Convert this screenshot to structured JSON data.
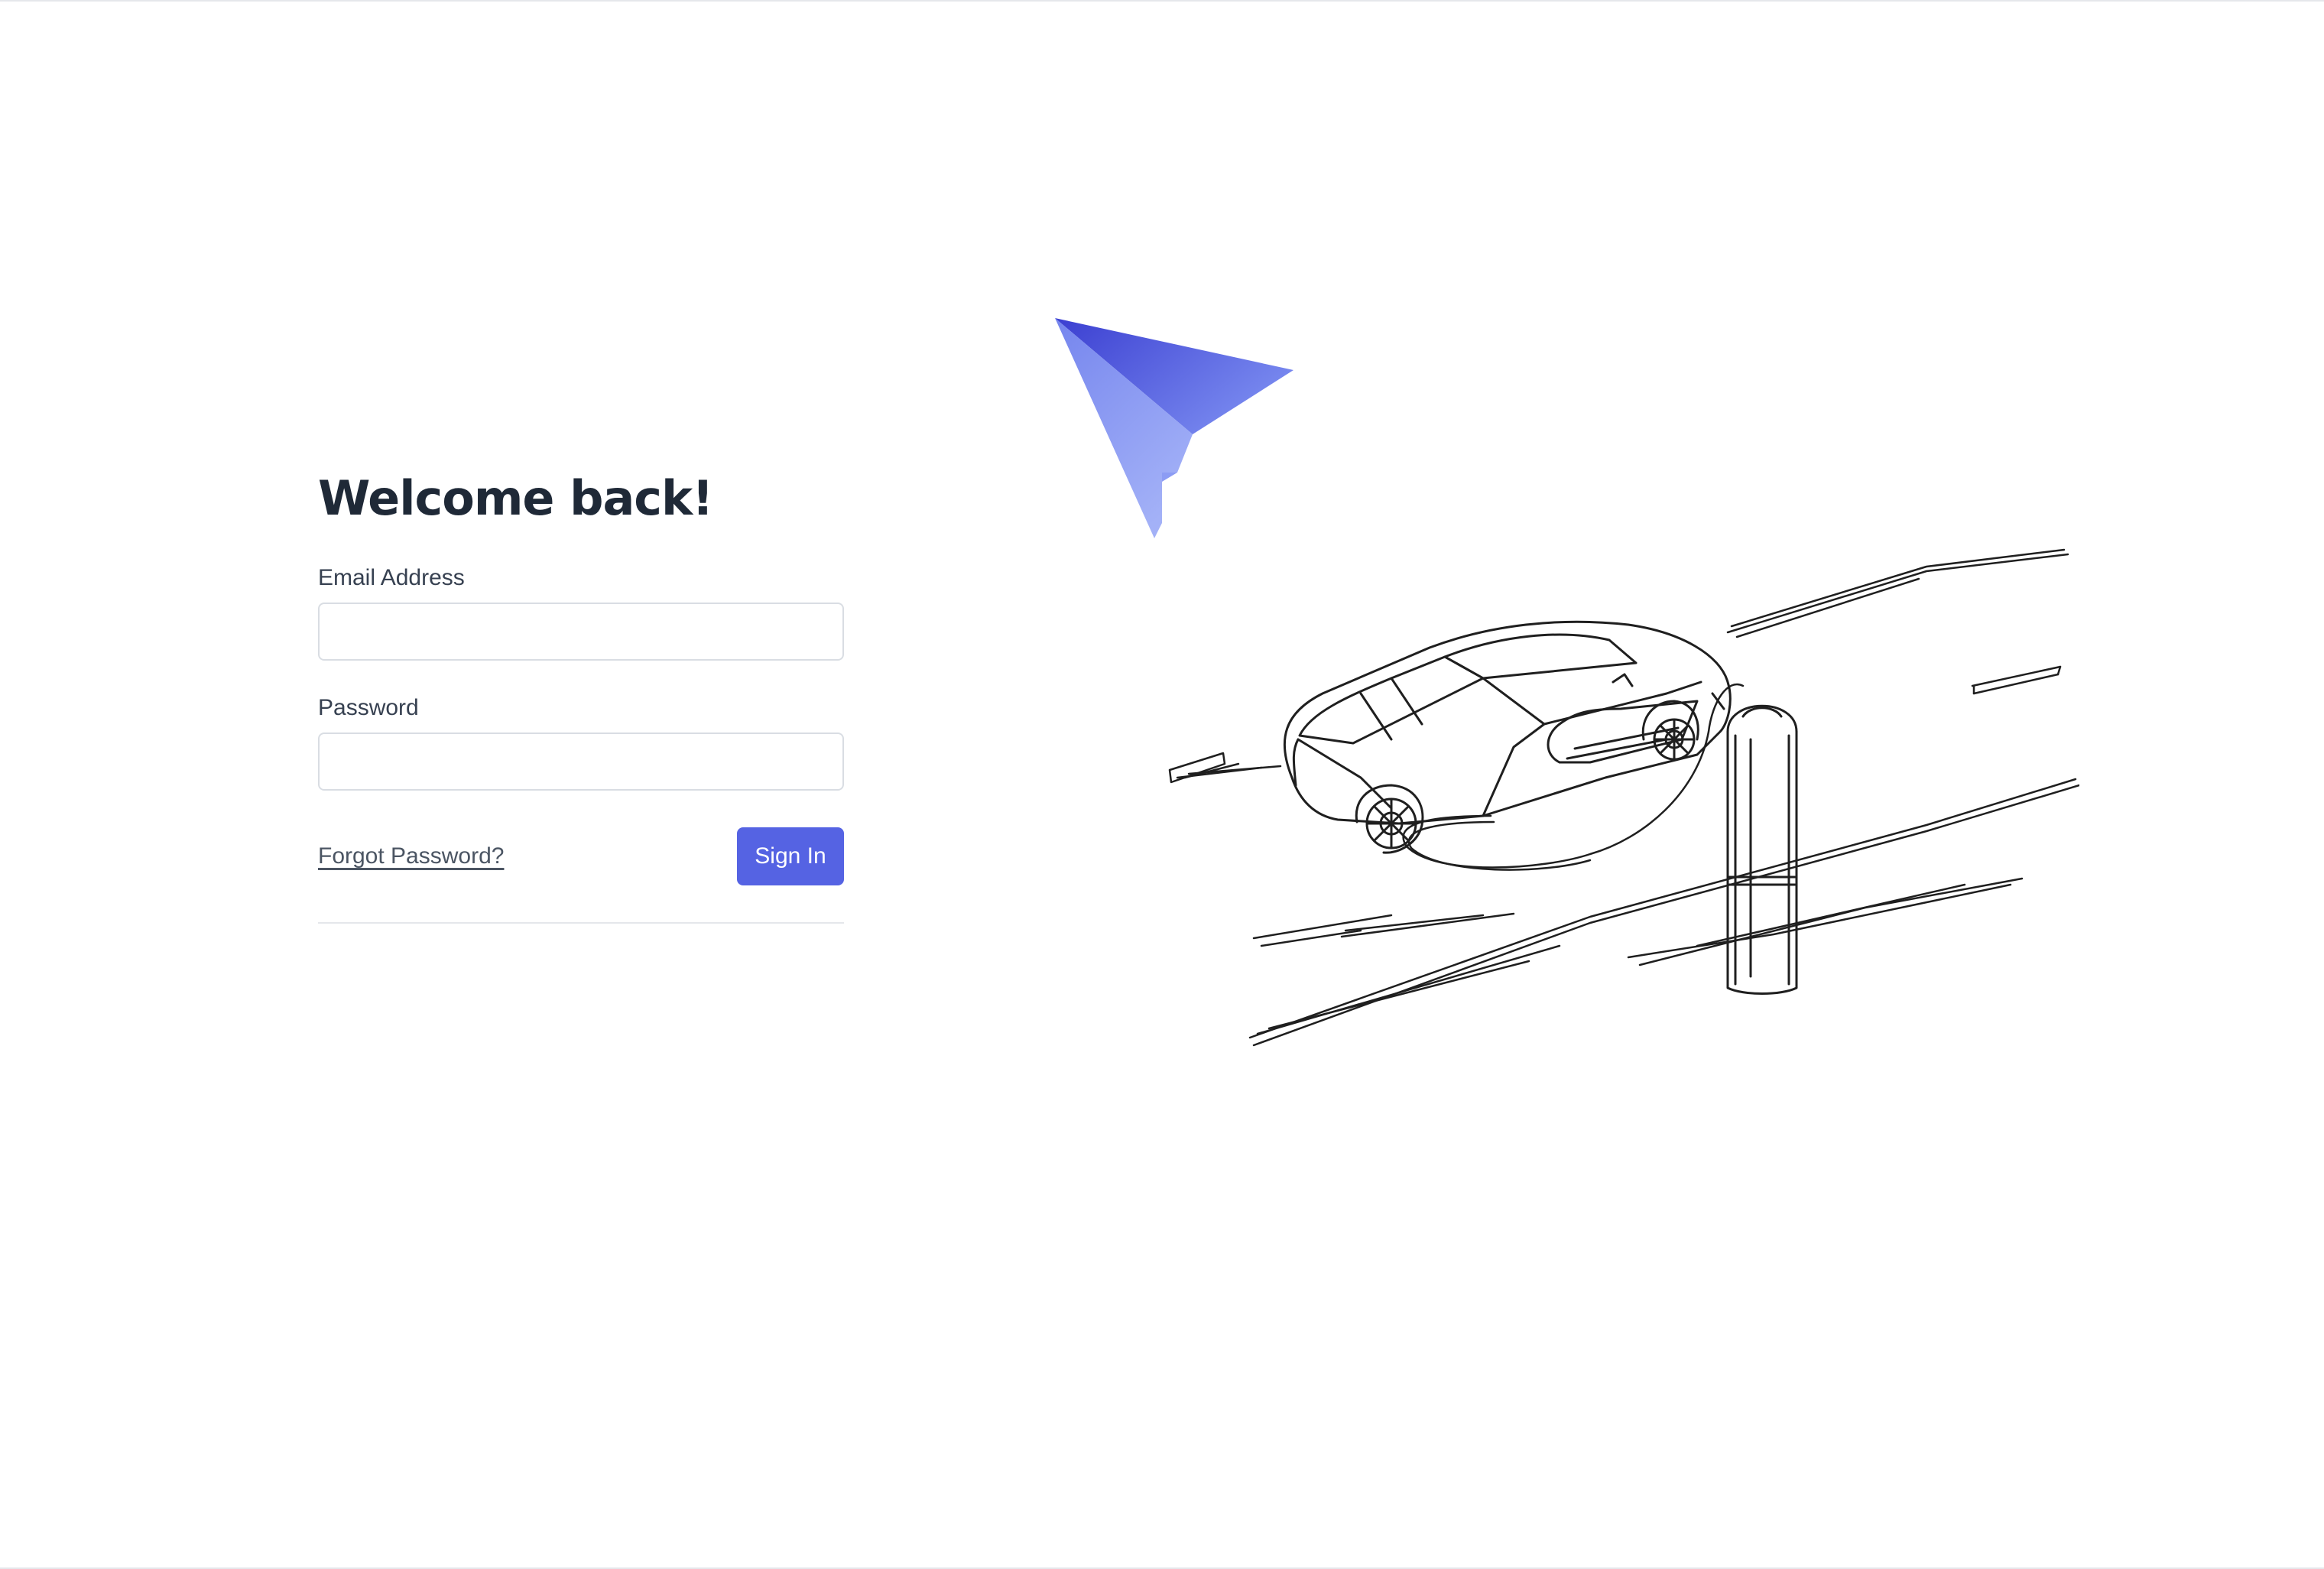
{
  "login": {
    "title": "Welcome back!",
    "email_label": "Email Address",
    "email_value": "",
    "password_label": "Password",
    "password_value": "",
    "forgot_link": "Forgot Password?",
    "signin_label": "Sign In"
  },
  "icons": {
    "logo": "paper-plane-logo-icon",
    "illustration": "electric-car-charging-sketch"
  },
  "colors": {
    "primary": "#5563e3",
    "heading": "#1f2937",
    "label": "#374151",
    "input_border": "#d9dde3",
    "logo_dark": "#3b3fd1",
    "logo_light": "#93a4f4"
  }
}
